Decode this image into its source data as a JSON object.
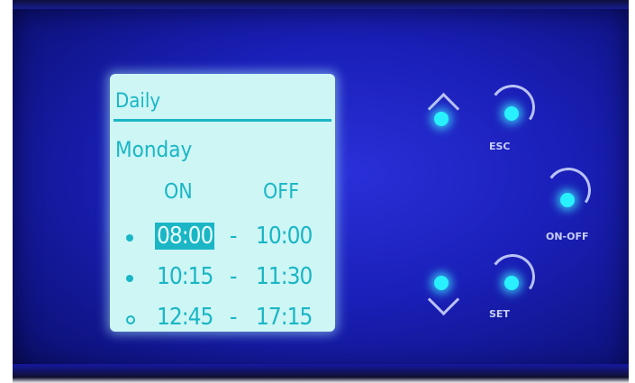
{
  "lcd": {
    "title": "Daily",
    "day": "Monday",
    "header_on": "ON",
    "header_off": "OFF",
    "rows": [
      {
        "on": "08:00",
        "separator": "-",
        "off": "10:00",
        "selected": true,
        "marker": "filled-dot"
      },
      {
        "on": "10:15",
        "separator": "-",
        "off": "11:30",
        "selected": false,
        "marker": "filled-dot"
      },
      {
        "on": "12:45",
        "separator": "-",
        "off": "17:15",
        "selected": false,
        "marker": "hollow-dot"
      }
    ]
  },
  "buttons": {
    "up_icon": "chevron-up-icon",
    "down_icon": "chevron-down-icon",
    "esc_label": "ESC",
    "onoff_label": "ON-OFF",
    "set_label": "SET"
  },
  "colors": {
    "panel": "#1a1fb8",
    "lcd_background": "#cdf6f5",
    "lcd_text": "#1ab6c5",
    "button_led": "#29f0ff"
  }
}
